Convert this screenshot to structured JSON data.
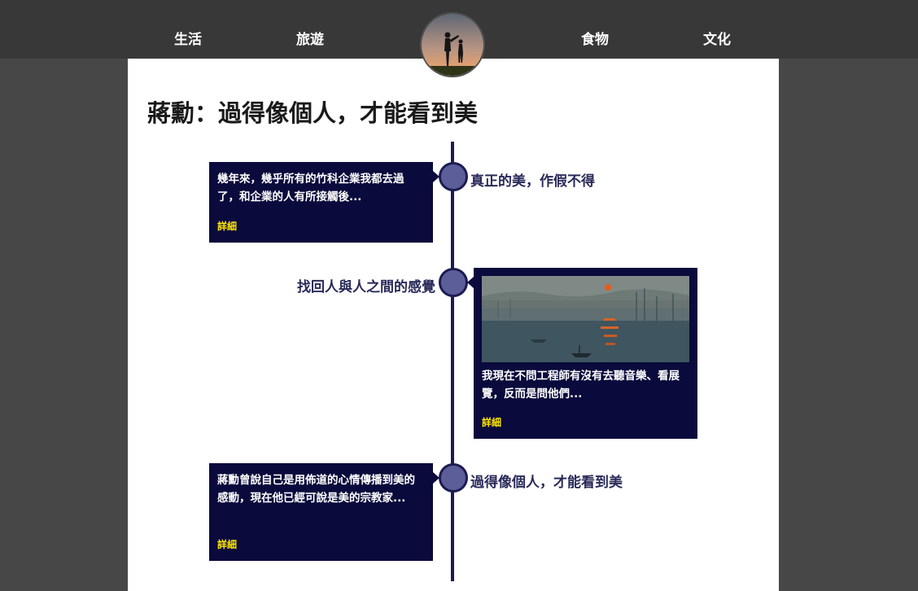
{
  "nav": {
    "items": [
      {
        "label": "生活"
      },
      {
        "label": "旅遊"
      },
      {
        "label": "食物"
      },
      {
        "label": "文化"
      }
    ]
  },
  "logo": {
    "icon": "father-child-silhouette-logo"
  },
  "article": {
    "title": "蔣勳：過得像個人，才能看到美"
  },
  "timeline": {
    "items": [
      {
        "heading": "真正的美，作假不得",
        "excerpt": "幾年來，幾乎所有的竹科企業我都去過了，和企業的人有所接觸後...",
        "more": "詳細"
      },
      {
        "heading": "找回人與人之間的感覺",
        "image": "impressionist-sunrise-painting",
        "excerpt": "我現在不問工程師有沒有去聽音樂、看展覽，反而是問他們...",
        "more": "詳細"
      },
      {
        "heading": "過得像個人，才能看到美",
        "excerpt": "蔣勳曾說自己是用佈道的心情傳播到美的感動，現在他已經可說是美的宗教家...",
        "more": "詳細"
      }
    ]
  },
  "colors": {
    "topbar": "#383838",
    "background": "#474747",
    "card": "#0a0a3c",
    "node": "#5c5e9a",
    "link": "#ffe600"
  }
}
